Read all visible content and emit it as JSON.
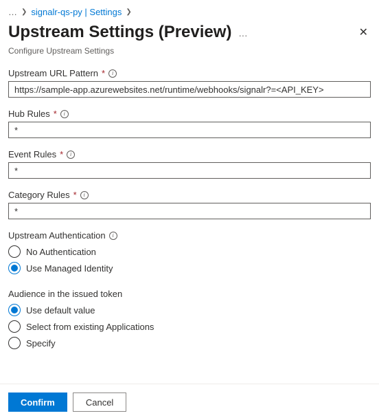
{
  "breadcrumb": {
    "ellipsis": "…",
    "link": "signalr-qs-py | Settings"
  },
  "header": {
    "title": "Upstream Settings (Preview)",
    "subtitle": "Configure Upstream Settings"
  },
  "fields": {
    "url_pattern": {
      "label": "Upstream URL Pattern",
      "value": "https://sample-app.azurewebsites.net/runtime/webhooks/signalr?=<API_KEY>"
    },
    "hub_rules": {
      "label": "Hub Rules",
      "value": "*"
    },
    "event_rules": {
      "label": "Event Rules",
      "value": "*"
    },
    "category_rules": {
      "label": "Category Rules",
      "value": "*"
    }
  },
  "auth": {
    "label": "Upstream Authentication",
    "options": {
      "none": "No Authentication",
      "managed": "Use Managed Identity"
    },
    "selected": "managed"
  },
  "audience": {
    "label": "Audience in the issued token",
    "options": {
      "default": "Use default value",
      "existing": "Select from existing Applications",
      "specify": "Specify"
    },
    "selected": "default"
  },
  "footer": {
    "confirm": "Confirm",
    "cancel": "Cancel"
  }
}
